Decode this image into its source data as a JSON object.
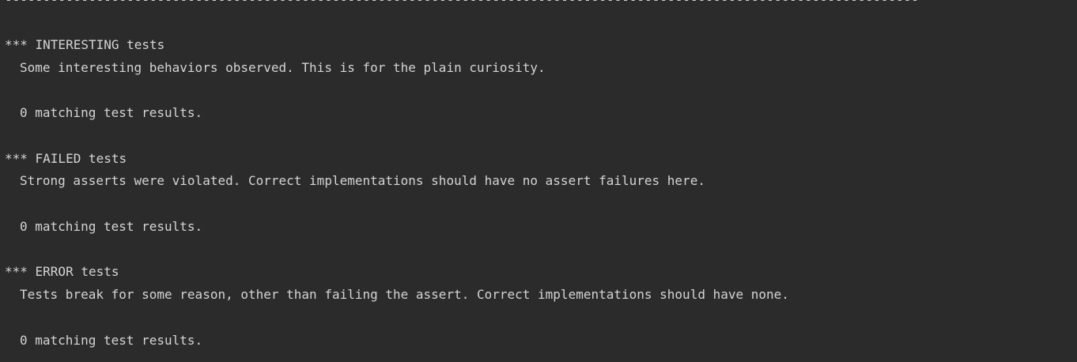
{
  "console": {
    "divider": "------------------------------------------------------------------------------------------------------------------------",
    "sections": [
      {
        "header": "*** INTERESTING tests",
        "description": "Some interesting behaviors observed. This is for the plain curiosity.",
        "result": "0 matching test results."
      },
      {
        "header": "*** FAILED tests",
        "description": "Strong asserts were violated. Correct implementations should have no assert failures here.",
        "result": "0 matching test results."
      },
      {
        "header": "*** ERROR tests",
        "description": "Tests break for some reason, other than failing the assert. Correct implementations should have none.",
        "result": "0 matching test results."
      }
    ]
  }
}
